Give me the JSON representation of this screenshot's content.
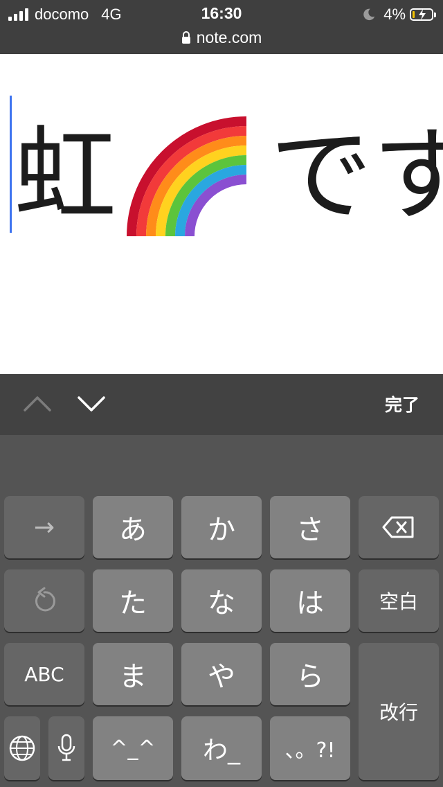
{
  "status_bar": {
    "carrier": "docomo",
    "network": "4G",
    "time": "16:30",
    "battery_percent": "4%",
    "battery_level": 0.04,
    "url": "note.com",
    "icons": [
      "signal-icon",
      "moon-icon",
      "battery-icon",
      "lock-icon"
    ]
  },
  "editor": {
    "text_before_emoji": "虹",
    "emoji_name": "rainbow",
    "text_after_emoji": "です。",
    "caret_color": "#3e74f0"
  },
  "accessory_bar": {
    "prev_icon": "chevron-up-icon",
    "next_icon": "chevron-down-icon",
    "done_label": "完了"
  },
  "keyboard": {
    "rows": [
      [
        "→",
        "あ",
        "か",
        "さ",
        "delete-icon"
      ],
      [
        "undo-icon",
        "た",
        "な",
        "は",
        "空白"
      ],
      [
        "ABC",
        "ま",
        "や",
        "ら",
        "改行"
      ],
      [
        "globe-icon",
        "mic-icon",
        "^^",
        "わ_",
        "、。?!"
      ]
    ],
    "arrow_key": "→",
    "a_key": "あ",
    "ka_key": "か",
    "sa_key": "さ",
    "ta_key": "た",
    "na_key": "な",
    "ha_key": "は",
    "space_key": "空白",
    "abc_key": "ABC",
    "ma_key": "ま",
    "ya_key": "や",
    "ra_key": "ら",
    "return_key": "改行",
    "kaomoji_key": "^_^",
    "wa_key": "わ_",
    "punct_key": "、。?!",
    "colors": {
      "light_key": "#828282",
      "dark_key": "#666666",
      "background": "#545454"
    }
  }
}
